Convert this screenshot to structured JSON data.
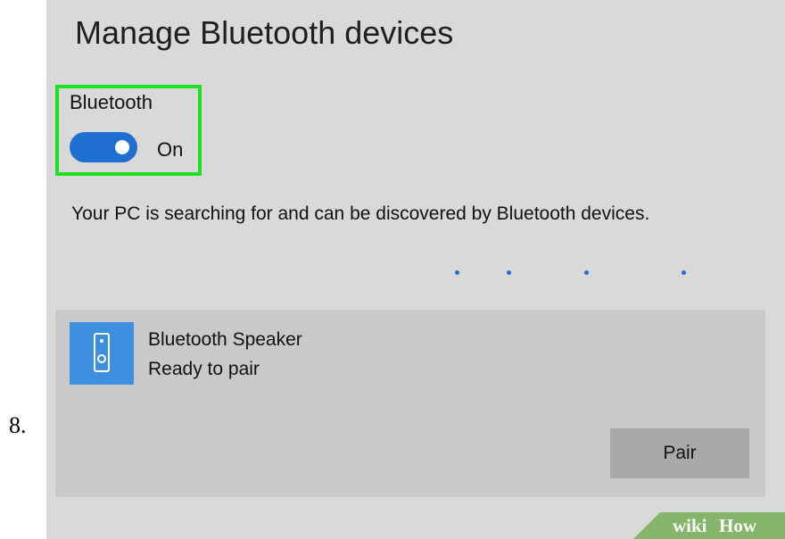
{
  "step": {
    "number": "8."
  },
  "page": {
    "title": "Manage Bluetooth devices"
  },
  "bluetooth": {
    "label": "Bluetooth",
    "toggle_on": true,
    "state": "On",
    "status_text": "Your PC is searching for and can be discovered by Bluetooth devices."
  },
  "device": {
    "icon": "speaker-icon",
    "name": "Bluetooth Speaker",
    "status": "Ready to pair",
    "pair_label": "Pair"
  },
  "watermark": {
    "wiki": "wiki",
    "how": "How"
  },
  "colors": {
    "accent": "#1f6fd1",
    "highlight": "#1fe01f",
    "panel_bg": "#d9d9d9",
    "card_bg": "#c9c9c9",
    "button_bg": "#a9a9a9",
    "device_icon_bg": "#3f8fe0"
  }
}
